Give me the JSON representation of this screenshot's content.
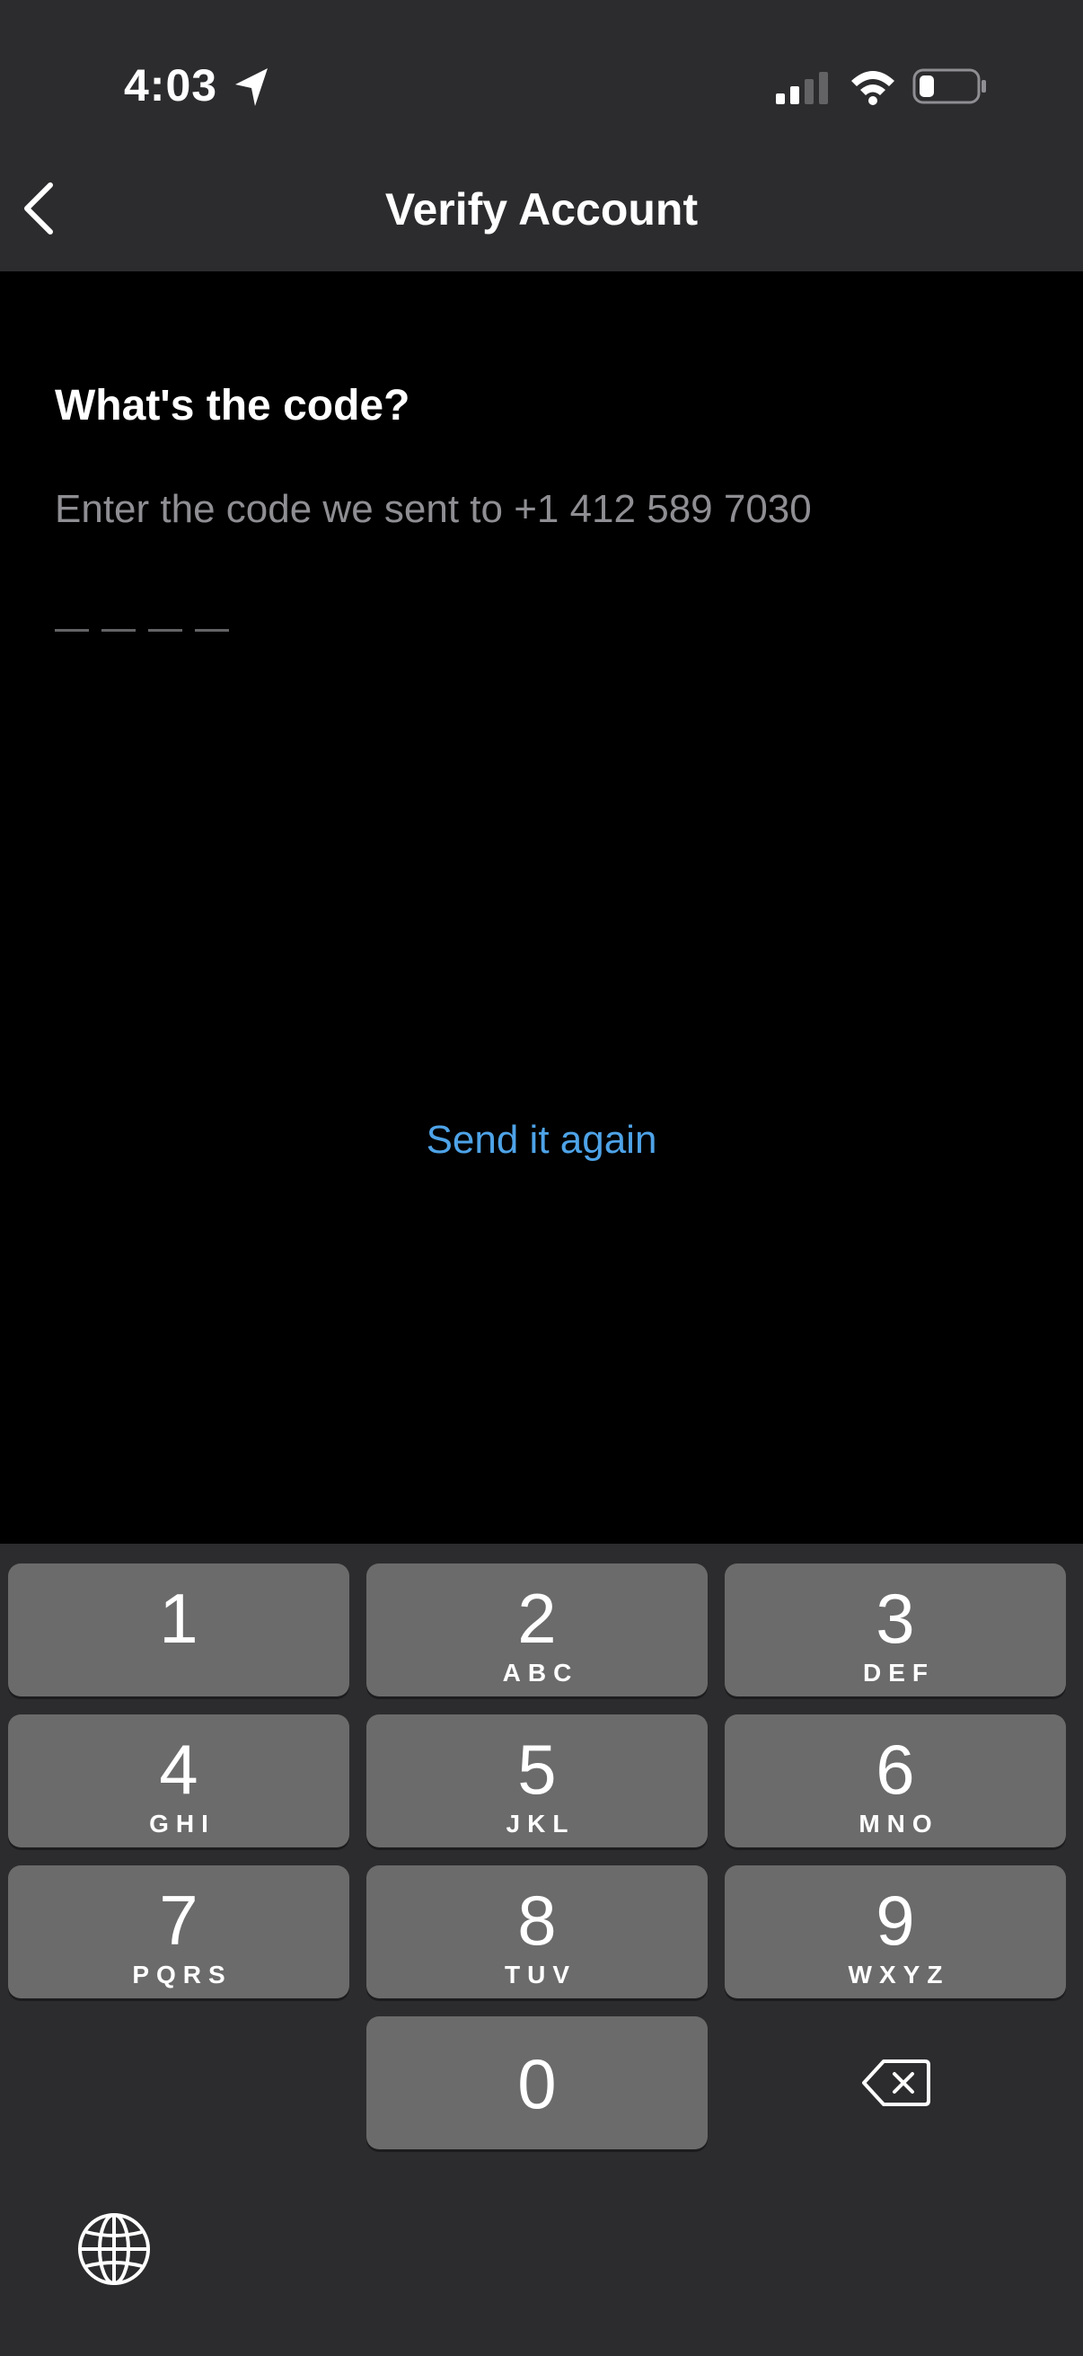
{
  "status_bar": {
    "time": "4:03"
  },
  "nav": {
    "title": "Verify Account"
  },
  "content": {
    "heading": "What's the code?",
    "subtitle": "Enter the code we sent to +1 412 589 7030",
    "resend_label": "Send it again"
  },
  "colors": {
    "header_bg": "#2c2c2e",
    "accent_link": "#4ea3e8",
    "key_bg": "#6b6b6b"
  },
  "keypad": {
    "keys": [
      {
        "digit": "1",
        "letters": ""
      },
      {
        "digit": "2",
        "letters": "ABC"
      },
      {
        "digit": "3",
        "letters": "DEF"
      },
      {
        "digit": "4",
        "letters": "GHI"
      },
      {
        "digit": "5",
        "letters": "JKL"
      },
      {
        "digit": "6",
        "letters": "MNO"
      },
      {
        "digit": "7",
        "letters": "PQRS"
      },
      {
        "digit": "8",
        "letters": "TUV"
      },
      {
        "digit": "9",
        "letters": "WXYZ"
      },
      {
        "digit": "0",
        "letters": ""
      }
    ]
  }
}
